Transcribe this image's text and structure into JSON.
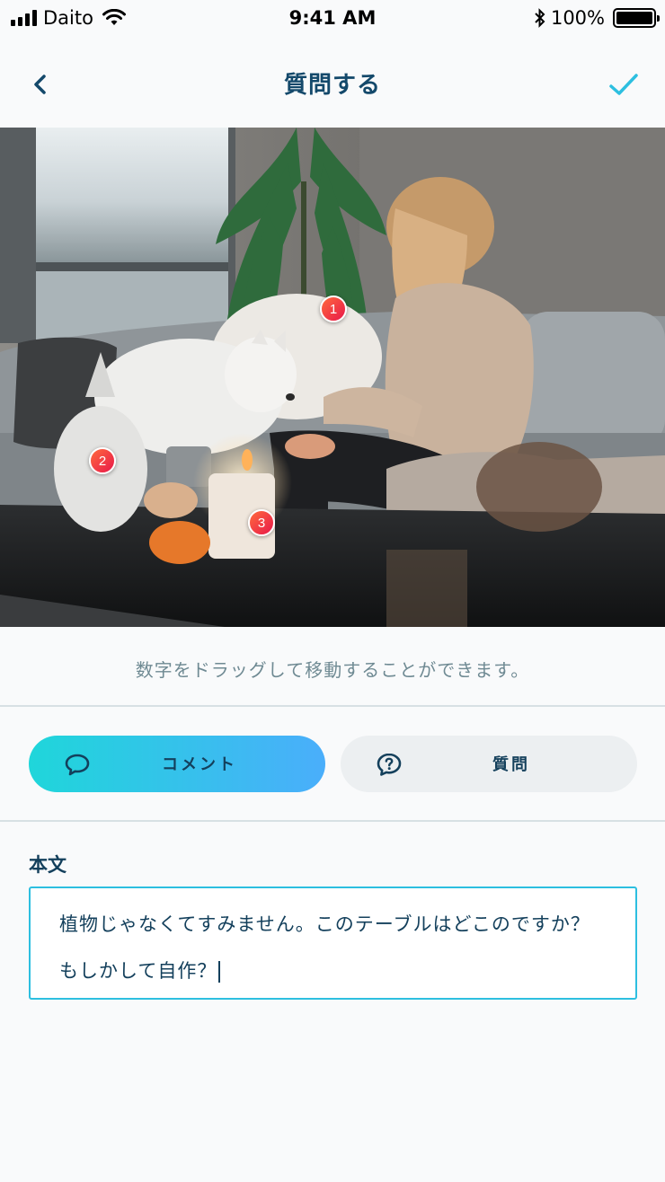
{
  "status_bar": {
    "carrier": "Daito",
    "time": "9:41 AM",
    "battery": "100%"
  },
  "nav": {
    "title": "質問する"
  },
  "photo": {
    "pins": [
      {
        "number": "1"
      },
      {
        "number": "2"
      },
      {
        "number": "3"
      }
    ]
  },
  "hint": "数字をドラッグして移動することができます。",
  "mode_toggle": {
    "comment_label": "コメント",
    "question_label": "質問",
    "selected": "comment"
  },
  "body_field": {
    "label": "本文",
    "value": "植物じゃなくてすみません。このテーブルはどこのですか？もしかして自作？"
  },
  "colors": {
    "accent": "#2dbfe0",
    "title": "#14496b",
    "gradient_start": "#1fd6da",
    "gradient_end": "#4aaefb",
    "pin": "#f0363d"
  }
}
